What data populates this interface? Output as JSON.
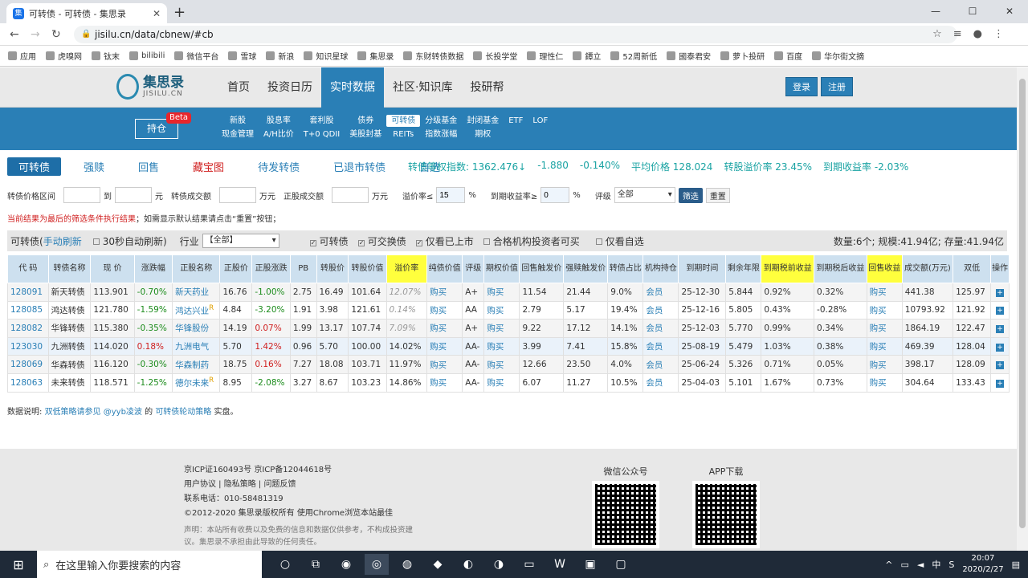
{
  "browser": {
    "tab_title": "可转债 - 可转债 - 集思录",
    "url": "jisilu.cn/data/cbnew/#cb",
    "bookmarks": [
      "应用",
      "虎嗅网",
      "钛末",
      "bilibili",
      "微信平台",
      "雪球",
      "新浪",
      "知识星球",
      "集思录",
      "东财转债数据",
      "长投学堂",
      "理性仁",
      "鐔立",
      "52周新低",
      "國泰君安",
      "萝卜投研",
      "百度",
      "华尔街文摘"
    ]
  },
  "site": {
    "logo_cn": "集思录",
    "logo_en": "JISILU.CN",
    "nav": [
      "首页",
      "投资日历",
      "实时数据",
      "社区·知识库",
      "投研帮"
    ],
    "nav_active": 2,
    "login": "登录",
    "register": "注册",
    "hold_btn": "持仓",
    "beta": "Beta",
    "sublinks_row1": [
      "新股",
      "股息率",
      "套利股",
      "债券",
      "可转债",
      "分级基金",
      "封闭基金",
      "ETF",
      "LOF"
    ],
    "sublinks_row2": [
      "现金管理",
      "A/H比价",
      "T+0 QDII",
      "美股封基",
      "REITs",
      "指数涨幅",
      "期权"
    ]
  },
  "tabs": [
    "可转债",
    "强赎",
    "回售",
    "藏宝图",
    "待发转债",
    "已退市转债",
    "自选"
  ],
  "stats": {
    "index_label": "转债等权指数:",
    "index_value": "1362.476",
    "index_arrow": "↓",
    "change": "-1.880",
    "change_pct": "-0.140%",
    "avg_price": "平均价格 128.024",
    "premium": "转股溢价率 23.45%",
    "ytm": "到期收益率 -2.03%"
  },
  "filters": {
    "price_range": "转债价格区间",
    "to": "到",
    "yuan": "元",
    "volume": "转债成交额",
    "wan_yuan": "万元",
    "stock_volume": "正股成交额",
    "premium_label": "溢价率≤",
    "premium_value": "15",
    "pct": "%",
    "ytm_label": "到期收益率≥",
    "ytm_value": "0",
    "rating_label": "评级",
    "rating_value": "全部",
    "filter_btn": "筛选",
    "reset_btn": "重置"
  },
  "notice": {
    "red": "当前结果为最后的筛选条件执行结果",
    "rest": "；如需显示默认结果请点击“重置”按钮；"
  },
  "toolbar": {
    "label": "可转债(",
    "manual": "手动刷新",
    "auto": "30秒自动刷新)",
    "industry": "行业",
    "industry_value": "【全部】",
    "cb1": "可转债",
    "cb2": "可交换债",
    "cb3": "仅看已上市",
    "cb4": "合格机构投资者可买",
    "cb5": "仅看自选",
    "summary": "数量:6个; 规模:41.94亿; 存量:41.94亿"
  },
  "table": {
    "headers": [
      "代 码",
      "转债名称",
      "现 价",
      "涨跌幅",
      "正股名称",
      "正股价",
      "正股涨跌",
      "PB",
      "转股价",
      "转股价值",
      "溢价率",
      "纯债价值",
      "评级",
      "期权价值",
      "回售触发价",
      "强赎触发价",
      "转债占比",
      "机构持仓",
      "到期时间",
      "剩余年限",
      "到期税前收益",
      "到期税后收益",
      "回售收益",
      "成交额(万元)",
      "双低",
      "操作"
    ],
    "rows": [
      {
        "code": "128091",
        "name": "新天转债",
        "price": "113.901",
        "chg": "-0.70%",
        "stock": "新天药业",
        "r": "",
        "sprice": "16.76",
        "schg": "-1.00%",
        "pb": "2.75",
        "conv": "16.49",
        "cval": "101.64",
        "prem": "12.07%",
        "bond": "购买",
        "rating": "A+",
        "opt": "购买",
        "put": "11.54",
        "call": "21.44",
        "ratio": "9.0%",
        "inst": "会员",
        "mat": "25-12-30",
        "yrs": "5.844",
        "ytm": "0.92%",
        "ytm2": "0.32%",
        "putret": "购买",
        "amt": "441.38",
        "dual": "125.97"
      },
      {
        "code": "128085",
        "name": "鸿达转债",
        "price": "121.780",
        "chg": "-1.59%",
        "stock": "鸿达兴业",
        "r": "R",
        "sprice": "4.84",
        "schg": "-3.20%",
        "pb": "1.91",
        "conv": "3.98",
        "cval": "121.61",
        "prem": "0.14%",
        "bond": "购买",
        "rating": "AA",
        "opt": "购买",
        "put": "2.79",
        "call": "5.17",
        "ratio": "19.4%",
        "inst": "会员",
        "mat": "25-12-16",
        "yrs": "5.805",
        "ytm": "0.43%",
        "ytm2": "-0.28%",
        "putret": "购买",
        "amt": "10793.92",
        "dual": "121.92"
      },
      {
        "code": "128082",
        "name": "华锋转债",
        "price": "115.380",
        "chg": "-0.35%",
        "stock": "华锋股份",
        "r": "",
        "sprice": "14.19",
        "schg": "0.07%",
        "pb": "1.99",
        "conv": "13.17",
        "cval": "107.74",
        "prem": "7.09%",
        "bond": "购买",
        "rating": "A+",
        "opt": "购买",
        "put": "9.22",
        "call": "17.12",
        "ratio": "14.1%",
        "inst": "会员",
        "mat": "25-12-03",
        "yrs": "5.770",
        "ytm": "0.99%",
        "ytm2": "0.34%",
        "putret": "购买",
        "amt": "1864.19",
        "dual": "122.47"
      },
      {
        "code": "123030",
        "name": "九洲转债",
        "price": "114.020",
        "chg": "0.18%",
        "stock": "九洲电气",
        "r": "",
        "sprice": "5.70",
        "schg": "1.42%",
        "pb": "0.96",
        "conv": "5.70",
        "cval": "100.00",
        "prem": "14.02%",
        "bond": "购买",
        "rating": "AA-",
        "opt": "购买",
        "put": "3.99",
        "call": "7.41",
        "ratio": "15.8%",
        "inst": "会员",
        "mat": "25-08-19",
        "yrs": "5.479",
        "ytm": "1.03%",
        "ytm2": "0.38%",
        "putret": "购买",
        "amt": "469.39",
        "dual": "128.04"
      },
      {
        "code": "128069",
        "name": "华森转债",
        "price": "116.120",
        "chg": "-0.30%",
        "stock": "华森制药",
        "r": "",
        "sprice": "18.75",
        "schg": "0.16%",
        "pb": "7.27",
        "conv": "18.08",
        "cval": "103.71",
        "prem": "11.97%",
        "bond": "购买",
        "rating": "AA-",
        "opt": "购买",
        "put": "12.66",
        "call": "23.50",
        "ratio": "4.0%",
        "inst": "会员",
        "mat": "25-06-24",
        "yrs": "5.326",
        "ytm": "0.71%",
        "ytm2": "0.05%",
        "putret": "购买",
        "amt": "398.17",
        "dual": "128.09"
      },
      {
        "code": "128063",
        "name": "未来转债",
        "price": "118.571",
        "chg": "-1.25%",
        "stock": "德尔未来",
        "r": "R",
        "sprice": "8.95",
        "schg": "-2.08%",
        "pb": "3.27",
        "conv": "8.67",
        "cval": "103.23",
        "prem": "14.86%",
        "bond": "购买",
        "rating": "AA-",
        "opt": "购买",
        "put": "6.07",
        "call": "11.27",
        "ratio": "10.5%",
        "inst": "会员",
        "mat": "25-04-03",
        "yrs": "5.101",
        "ytm": "1.67%",
        "ytm2": "0.73%",
        "putret": "购买",
        "amt": "304.64",
        "dual": "133.43"
      }
    ]
  },
  "dataline": {
    "a": "数据说明:",
    "b": "双低策略请参见",
    "c": "@yyb凌波",
    "d": "的",
    "e": "可转债轮动策略",
    "f": "实盘。"
  },
  "footer": {
    "icp": "京ICP证160493号 京ICP备12044618号",
    "links": "用户协议 | 隐私策略 | 问题反馈",
    "phone": "联系电话：010-58481319",
    "copy": "©2012-2020 集思录版权所有 使用Chrome浏览本站最佳",
    "disc1": "声明：本站所有收费以及免费的信息和数据仅供参考，不构成投资建",
    "disc2": "议。集思录不承担由此导致的任何责任。",
    "wechat": "微信公众号",
    "app": "APP下载"
  },
  "taskbar": {
    "search": "在这里输入你要搜索的内容",
    "time": "20:07",
    "date": "2020/2/27",
    "ime": "中"
  }
}
